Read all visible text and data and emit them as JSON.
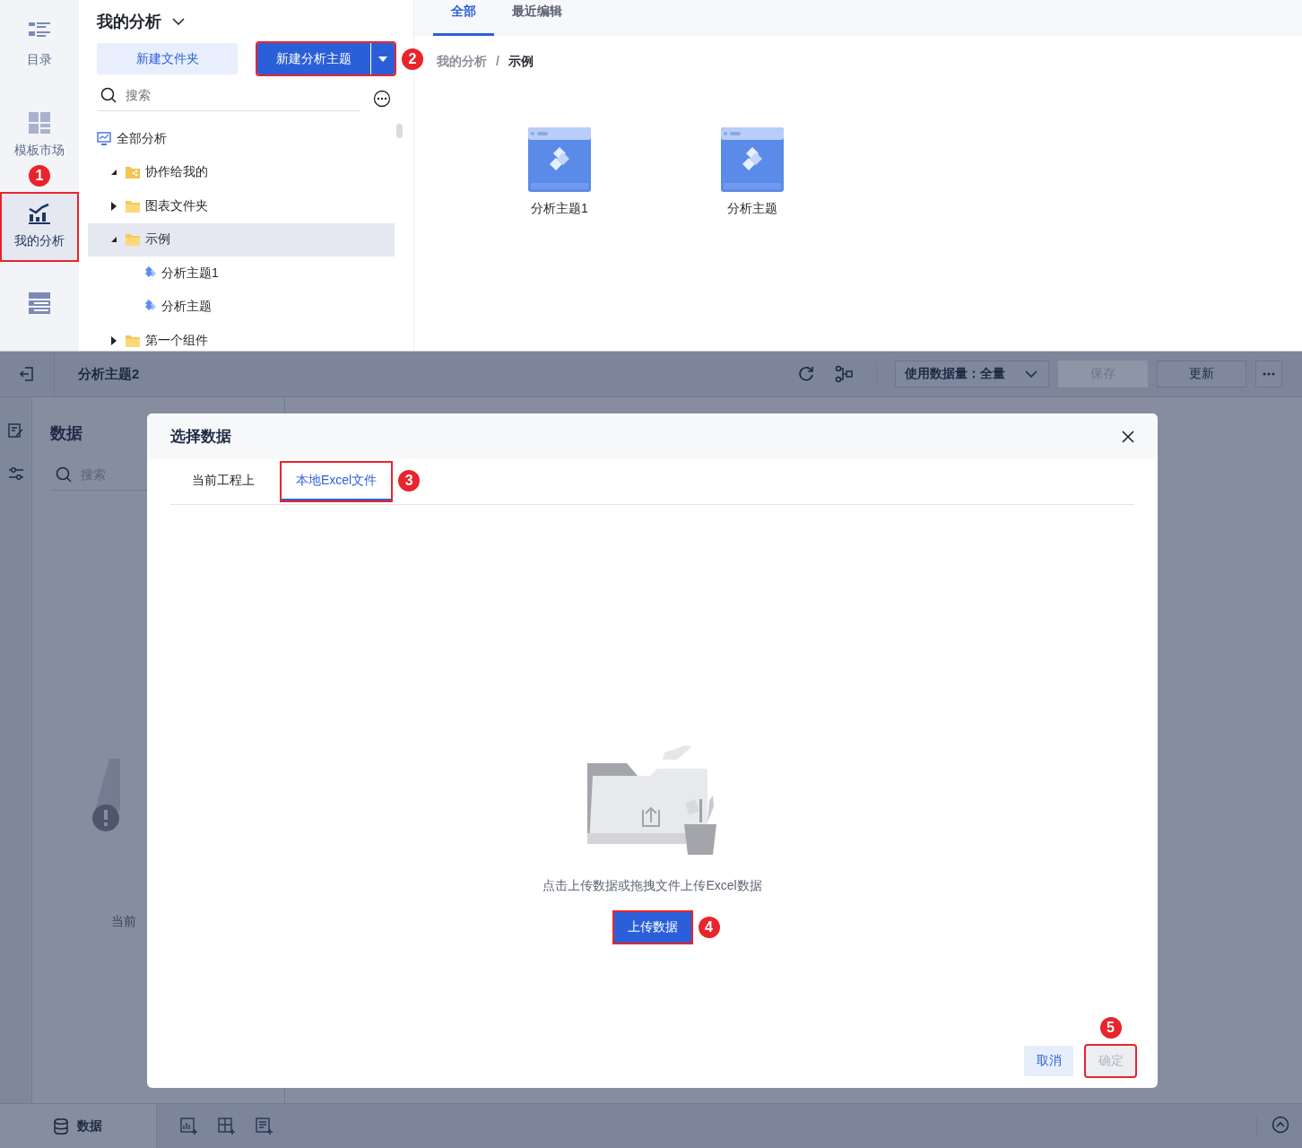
{
  "top": {
    "rail": [
      {
        "label": "目录",
        "selected": false,
        "highlighted": false
      },
      {
        "label": "模板市场",
        "selected": false,
        "highlighted": false
      },
      {
        "label": "我的分析",
        "selected": true,
        "highlighted": true,
        "callout": "1"
      },
      {
        "selected": false,
        "highlighted": false
      }
    ],
    "panel_title": "我的分析",
    "buttons": [
      {
        "label": "新建文件夹",
        "kind": "secondary",
        "highlighted": false
      },
      {
        "label": "新建分析主题",
        "kind": "split",
        "highlighted": true,
        "callout": "2"
      }
    ],
    "search": {
      "placeholder": "搜索"
    },
    "tree": [
      {
        "label": "全部分析",
        "kind": "root",
        "selected": false,
        "children": [
          {
            "label": "协作给我的",
            "kind": "shared-folder",
            "expanded": true,
            "selected": false
          },
          {
            "label": "图表文件夹",
            "kind": "folder",
            "expanded": false,
            "selected": false
          },
          {
            "label": "示例",
            "kind": "folder",
            "expanded": true,
            "selected": true,
            "children": [
              {
                "label": "分析主题1",
                "kind": "theme",
                "selected": false
              },
              {
                "label": "分析主题",
                "kind": "theme",
                "selected": false
              }
            ]
          },
          {
            "label": "第一个组件",
            "kind": "folder",
            "expanded": false,
            "selected": false
          }
        ]
      }
    ],
    "tabs": [
      {
        "label": "全部",
        "selected": true
      },
      {
        "label": "最近编辑",
        "selected": false
      }
    ],
    "breadcrumb": [
      "我的分析",
      "示例"
    ],
    "breadcrumb_separator": "/",
    "cards": [
      {
        "label": "分析主题1"
      },
      {
        "label": "分析主题"
      }
    ]
  },
  "bottom": {
    "title": "分析主题2",
    "data_scope": "使用数据量：全量",
    "buttons": [
      {
        "label": "保存",
        "disabled": true
      },
      {
        "label": "更新",
        "disabled": false
      }
    ],
    "panel_title": "数据",
    "search": {
      "placeholder": "搜索"
    },
    "empty_text": "当前",
    "footer_tab": "数据",
    "modal": {
      "title": "选择数据",
      "tabs": [
        {
          "label": "当前工程上",
          "selected": false,
          "highlighted": false
        },
        {
          "label": "本地Excel文件",
          "selected": true,
          "highlighted": true,
          "callout": "3"
        }
      ],
      "hint": "点击上传数据或拖拽文件上传Excel数据",
      "upload": {
        "label": "上传数据",
        "highlighted": true,
        "callout": "4"
      },
      "cancel": {
        "label": "取消",
        "disabled": false,
        "highlighted": false
      },
      "confirm": {
        "label": "确定",
        "disabled": true,
        "highlighted": true,
        "callout": "5"
      }
    }
  }
}
